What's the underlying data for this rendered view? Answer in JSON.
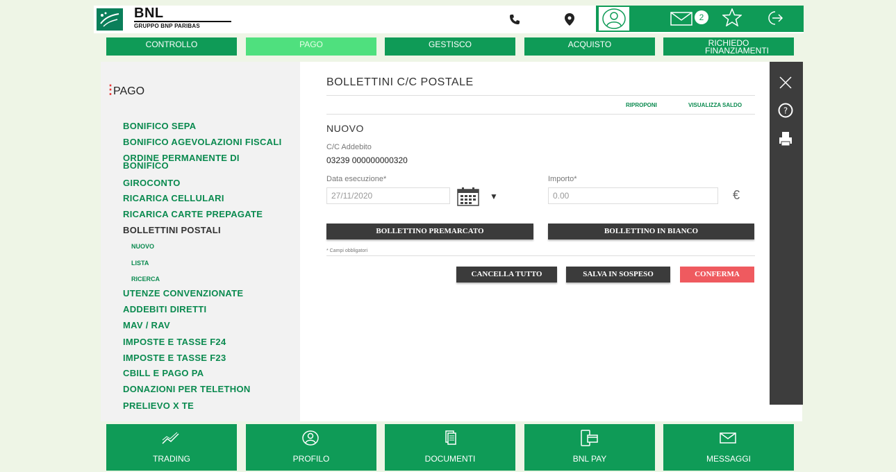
{
  "brand": {
    "name": "BNL",
    "group": "GRUPPO BNP PARIBAS"
  },
  "header": {
    "messages_badge": "2"
  },
  "nav": [
    {
      "label": "CONTROLLO"
    },
    {
      "label": "PAGO"
    },
    {
      "label": "GESTISCO"
    },
    {
      "label": "ACQUISTO"
    },
    {
      "label": "RICHIEDO FINANZIAMENTI"
    }
  ],
  "sidebar": {
    "title": "PAGO",
    "items": [
      "BONIFICO SEPA",
      "BONIFICO AGEVOLAZIONI FISCALI",
      "ORDINE PERMANENTE DI BONIFICO",
      "GIROCONTO",
      "RICARICA CELLULARI",
      "RICARICA CARTE PREPAGATE",
      "BOLLETTINI POSTALI",
      "UTENZE CONVENZIONATE",
      "ADDEBITI DIRETTI",
      "MAV / RAV",
      "IMPOSTE E TASSE F24",
      "IMPOSTE E TASSE F23",
      "CBILL E PAGO PA",
      "DONAZIONI PER TELETHON",
      "PRELIEVO X TE"
    ],
    "subitems": [
      "NUOVO",
      "LISTA",
      "RICERCA"
    ]
  },
  "content": {
    "title": "BOLLETTINI C/C POSTALE",
    "link_riproponi": "RIPROPONI",
    "link_saldo": "VISUALIZZA SALDO",
    "section_title": "NUOVO",
    "account_label": "C/C Addebito",
    "account_value": "03239 000000000320",
    "date_label": "Data esecuzione*",
    "date_value": "27/11/2020",
    "amount_label": "Importo*",
    "amount_value": "0.00",
    "currency": "€",
    "btn_premarcato": "BOLLETTINO PREMARCATO",
    "btn_bianco": "BOLLETTINO IN BIANCO",
    "required_note": "* Campi obbligatori",
    "btn_cancella": "CANCELLA TUTTO",
    "btn_salva": "SALVA IN SOSPESO",
    "btn_conferma": "CONFERMA"
  },
  "bottom": [
    {
      "label": "TRADING",
      "icon": "chart-line-icon"
    },
    {
      "label": "PROFILO",
      "icon": "user-icon"
    },
    {
      "label": "DOCUMENTI",
      "icon": "document-icon"
    },
    {
      "label": "BNL PAY",
      "icon": "mobile-pay-icon"
    },
    {
      "label": "MESSAGGI",
      "icon": "mail-icon"
    }
  ],
  "colors": {
    "brand_green": "#0f9b57",
    "active_green": "#4fe07e",
    "confirm_red": "#ef5a5f",
    "dark": "#3b3b3b"
  }
}
